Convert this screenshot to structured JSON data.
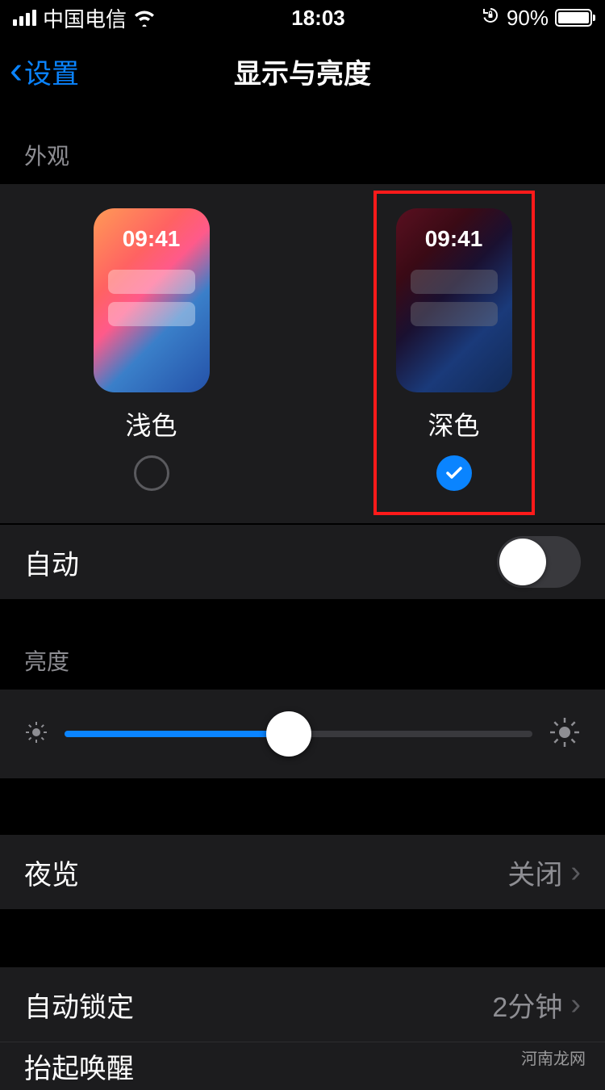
{
  "status": {
    "carrier": "中国电信",
    "time": "18:03",
    "battery_percent": "90%"
  },
  "nav": {
    "back_label": "设置",
    "title": "显示与亮度"
  },
  "sections": {
    "appearance_header": "外观",
    "brightness_header": "亮度"
  },
  "appearance": {
    "light": {
      "label": "浅色",
      "preview_time": "09:41",
      "selected": false
    },
    "dark": {
      "label": "深色",
      "preview_time": "09:41",
      "selected": true
    }
  },
  "rows": {
    "auto": {
      "label": "自动",
      "enabled": false
    },
    "night_shift": {
      "label": "夜览",
      "value": "关闭"
    },
    "auto_lock": {
      "label": "自动锁定",
      "value": "2分钟"
    },
    "raise_to_wake": {
      "label": "抬起唤醒"
    }
  },
  "brightness": {
    "value_percent": 48
  },
  "watermark": "河南龙网"
}
